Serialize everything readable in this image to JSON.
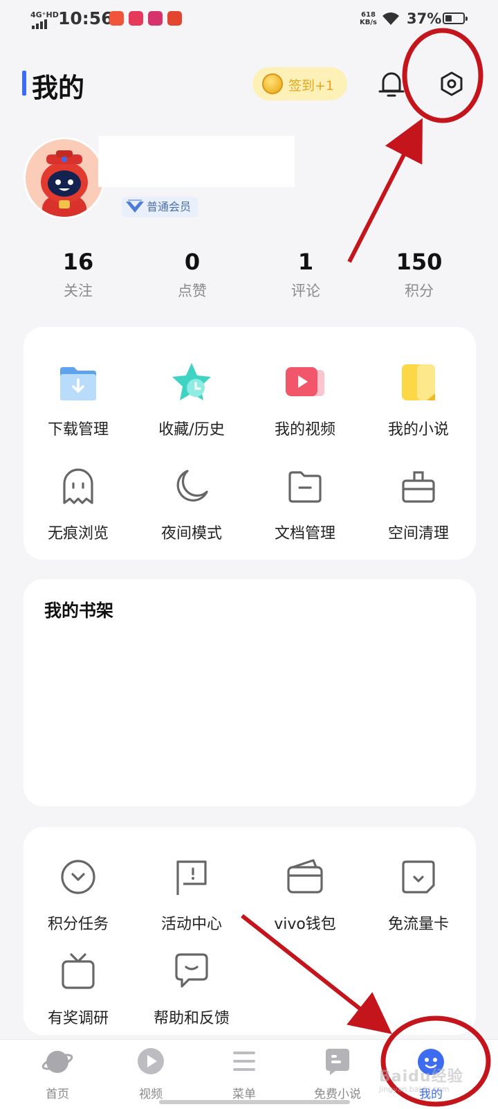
{
  "status_bar": {
    "network": "4G⁺HD",
    "time": "10:56",
    "speed_value": "618",
    "speed_unit": "KB/s",
    "battery_text": "37%",
    "battery_level": 0.37
  },
  "header": {
    "title": "我的",
    "checkin_label": "签到+1",
    "bell_icon": "bell-icon",
    "settings_icon": "settings-hexagon-icon"
  },
  "profile": {
    "member_level": "普通会员"
  },
  "stats": [
    {
      "value": "16",
      "label": "关注"
    },
    {
      "value": "0",
      "label": "点赞"
    },
    {
      "value": "1",
      "label": "评论"
    },
    {
      "value": "150",
      "label": "积分"
    }
  ],
  "tools": [
    {
      "label": "下载管理",
      "icon": "download-folder-icon"
    },
    {
      "label": "收藏/历史",
      "icon": "star-clock-icon"
    },
    {
      "label": "我的视频",
      "icon": "video-icon"
    },
    {
      "label": "我的小说",
      "icon": "book-icon"
    },
    {
      "label": "无痕浏览",
      "icon": "ghost-icon"
    },
    {
      "label": "夜间模式",
      "icon": "moon-icon"
    },
    {
      "label": "文档管理",
      "icon": "folder-icon"
    },
    {
      "label": "空间清理",
      "icon": "briefcase-icon"
    }
  ],
  "bookshelf": {
    "title": "我的书架"
  },
  "services": [
    {
      "label": "积分任务",
      "icon": "points-circle-icon"
    },
    {
      "label": "活动中心",
      "icon": "flag-icon"
    },
    {
      "label": "vivo钱包",
      "icon": "wallet-icon"
    },
    {
      "label": "免流量卡",
      "icon": "sim-card-icon"
    },
    {
      "label": "有奖调研",
      "icon": "tv-gift-icon"
    },
    {
      "label": "帮助和反馈",
      "icon": "chat-bubble-icon"
    }
  ],
  "bottom_nav": [
    {
      "label": "首页",
      "icon": "planet-icon",
      "active": false
    },
    {
      "label": "视频",
      "icon": "play-circle-icon",
      "active": false
    },
    {
      "label": "菜单",
      "icon": "menu-icon",
      "active": false
    },
    {
      "label": "免费小说",
      "icon": "book-bubble-icon",
      "active": false
    },
    {
      "label": "我的",
      "icon": "profile-face-icon",
      "active": true
    }
  ],
  "watermark": {
    "text": "Baidu经验",
    "sub": "jingyan.baidu.com"
  },
  "colors": {
    "accent": "#3d6cf0",
    "annotation": "#c4151c",
    "coin": "#e8a60c",
    "background": "#f5f5f7"
  }
}
